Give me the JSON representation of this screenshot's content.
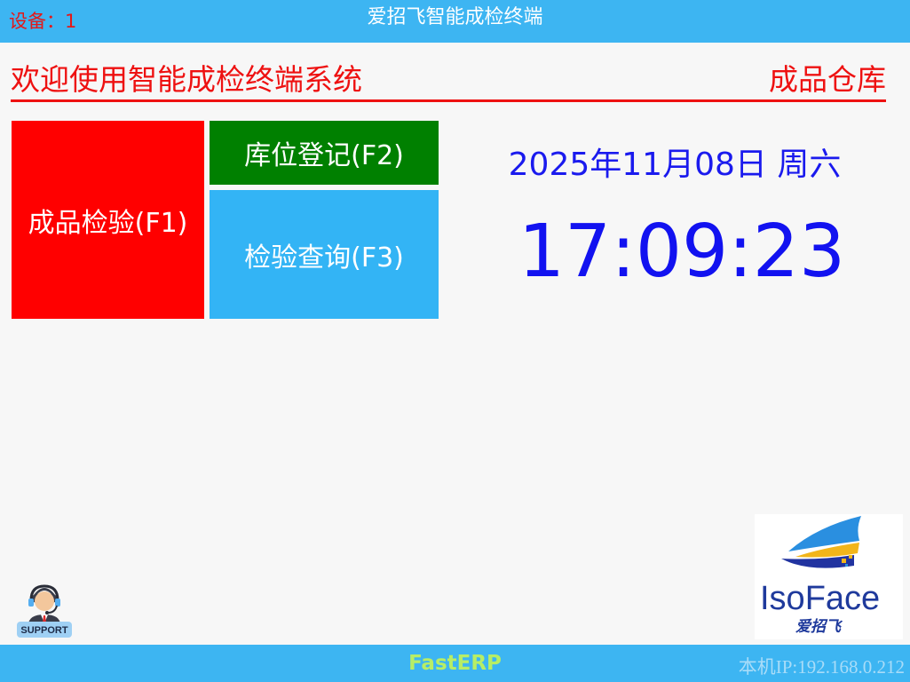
{
  "header": {
    "device_label": "设备：1",
    "title": "爱招飞智能成检终端"
  },
  "banner": {
    "welcome": "欢迎使用智能成检终端系统",
    "warehouse": "成品仓库"
  },
  "tiles": {
    "f1": "成品检验(F1)",
    "f2": "库位登记(F2)",
    "f3": "检验查询(F3)"
  },
  "clock": {
    "date": "2025年11月08日 周六",
    "time": "17:09:23"
  },
  "support": {
    "icon": "support-agent-icon",
    "label": "SUPPORT"
  },
  "logo": {
    "brand_text": "IsoFace",
    "brand_chinese": "爱招飞"
  },
  "footer": {
    "brand": "FastERP",
    "ip": "本机IP:192.168.0.212"
  },
  "colors": {
    "bar_blue": "#3db5f2",
    "alert_red": "#ff0000",
    "tile_green": "#008000",
    "tile_blue": "#33b4f5",
    "clock_blue": "#1212f0"
  }
}
